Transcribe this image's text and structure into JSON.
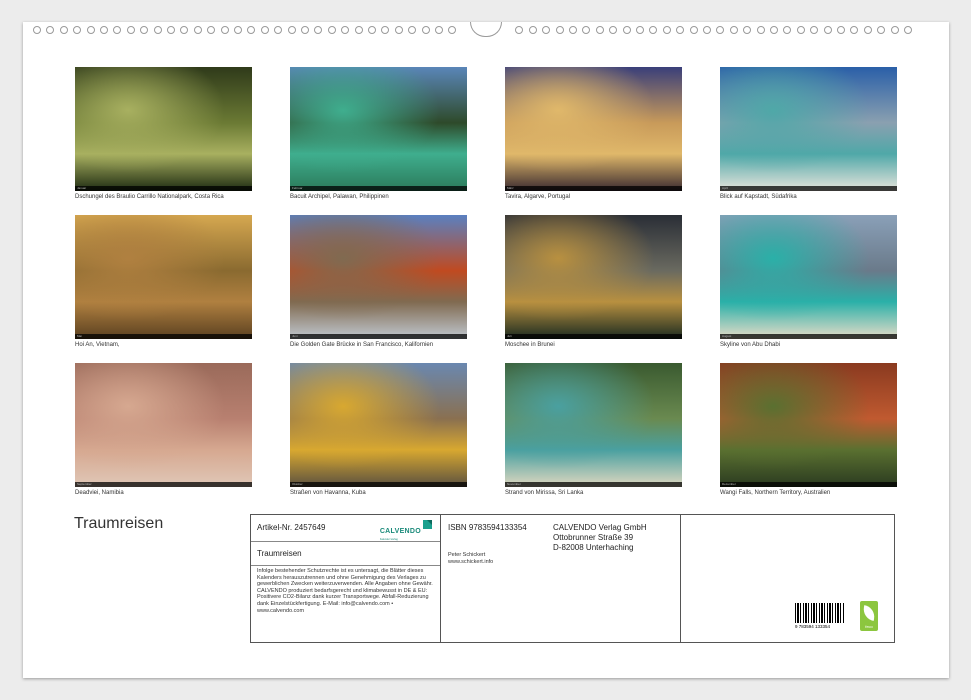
{
  "title": "Traumreisen",
  "photos": [
    {
      "caption": "Dschungel des Braulio Carrillo Nationalpark, Costa Rica",
      "month": "Januar",
      "colors": [
        "#2f3a1a",
        "#6b7a34",
        "#a8b060",
        "#1e2b12"
      ]
    },
    {
      "caption": "Bacuit Archipel, Palawan, Philippinen",
      "month": "Februar",
      "colors": [
        "#5a86b8",
        "#2e4a2a",
        "#3fae8e",
        "#2b7a5a"
      ]
    },
    {
      "caption": "Tavira, Algarve, Portugal",
      "month": "März",
      "colors": [
        "#3a3f7a",
        "#c89a5a",
        "#e0b86a",
        "#3a2a30"
      ]
    },
    {
      "caption": "Blick auf Kapstadt, Südafrika",
      "month": "April",
      "colors": [
        "#2a5fa8",
        "#8aa0b0",
        "#4fa8a8",
        "#e8e4dc"
      ]
    },
    {
      "caption": "Hoi An, Vietnam,",
      "month": "Mai",
      "colors": [
        "#d6a850",
        "#8a6a30",
        "#b08040",
        "#5a4020"
      ]
    },
    {
      "caption": "Die Golden Gate Brücke in San Francisco, Kalifornien",
      "month": "Juni",
      "colors": [
        "#5a80c0",
        "#c04a20",
        "#806a50",
        "#c0c8d0"
      ]
    },
    {
      "caption": "Moschee in Brunei",
      "month": "Juli",
      "colors": [
        "#2a2e36",
        "#6a6a60",
        "#b89040",
        "#1a2a20"
      ]
    },
    {
      "caption": "Skyline von Abu Dhabi",
      "month": "August",
      "colors": [
        "#8aa0b8",
        "#6a7a8a",
        "#2ab0a8",
        "#e8dcc8"
      ]
    },
    {
      "caption": "Deadviei, Namibia",
      "month": "September",
      "colors": [
        "#9a6a5a",
        "#b88070",
        "#d6a890",
        "#e0c8b8"
      ]
    },
    {
      "caption": "Straßen von Havanna, Kuba",
      "month": "Oktober",
      "colors": [
        "#6a88b0",
        "#8a7050",
        "#d8a830",
        "#5a5040"
      ]
    },
    {
      "caption": "Strand von Mirissa, Sri Lanka",
      "month": "November",
      "colors": [
        "#3a5a30",
        "#6a8a50",
        "#4aa0a0",
        "#e0d8c0"
      ]
    },
    {
      "caption": "Wangi Falls, Northern Territory, Australien",
      "month": "Dezember",
      "colors": [
        "#8a3a20",
        "#c05a30",
        "#5a7030",
        "#2a3a20"
      ]
    }
  ],
  "info": {
    "article": "Artikel-Nr. 2457649",
    "product_title": "Traumreisen",
    "calvendo_word": "CALVENDO",
    "calvendo_sub": "Kalender-Verlag",
    "legal": "Infolge bestehender Schutzrechte ist es untersagt, die Blätter dieses Kalenders herauszutrennen und ohne Genehmigung des Verlages zu gewerblichen Zwecken weiterzuverwenden. Alle Angaben ohne Gewähr. CALVENDO produziert bedarfsgerecht und klimabewusst in DE & EU: Positivere CO2-Bilanz dank kurzer Transportwege. Abfall-Reduzierung dank Einzelstückfertigung. E-Mail: info@calvendo.com • www.calvendo.com",
    "isbn": "ISBN 9783594133354",
    "publisher_name": "CALVENDO Verlag GmbH",
    "publisher_street": "Ottobrunner Straße 39",
    "publisher_city": "D-82008 Unterhaching",
    "author": "Peter Schickert",
    "author_web": "www.schickert.info",
    "barcode_number": "9 783594 133354",
    "eco_label": "feco"
  }
}
